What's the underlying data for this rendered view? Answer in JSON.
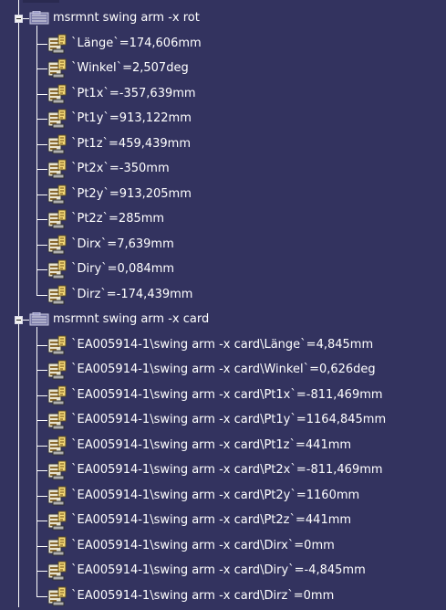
{
  "colors": {
    "background": "#33335f",
    "text": "#ffffff",
    "lines": "#ffffff"
  },
  "tree": [
    {
      "label": "msrmnt swing arm -x rot",
      "expanded": true,
      "icon": "parameter-set-icon",
      "children": [
        {
          "label": "`Länge`=174,606mm",
          "icon": "parameter-icon"
        },
        {
          "label": "`Winkel`=2,507deg",
          "icon": "parameter-icon"
        },
        {
          "label": "`Pt1x`=-357,639mm",
          "icon": "parameter-icon"
        },
        {
          "label": "`Pt1y`=913,122mm",
          "icon": "parameter-icon"
        },
        {
          "label": "`Pt1z`=459,439mm",
          "icon": "parameter-icon"
        },
        {
          "label": "`Pt2x`=-350mm",
          "icon": "parameter-icon"
        },
        {
          "label": "`Pt2y`=913,205mm",
          "icon": "parameter-icon"
        },
        {
          "label": "`Pt2z`=285mm",
          "icon": "parameter-icon"
        },
        {
          "label": "`Dirx`=7,639mm",
          "icon": "parameter-icon"
        },
        {
          "label": "`Diry`=0,084mm",
          "icon": "parameter-icon"
        },
        {
          "label": "`Dirz`=-174,439mm",
          "icon": "parameter-icon"
        }
      ]
    },
    {
      "label": "msrmnt swing arm -x card",
      "expanded": true,
      "icon": "parameter-set-icon",
      "children": [
        {
          "label": "`EA005914-1\\swing arm -x card\\Länge`=4,845mm",
          "icon": "parameter-icon"
        },
        {
          "label": "`EA005914-1\\swing arm -x card\\Winkel`=0,626deg",
          "icon": "parameter-icon"
        },
        {
          "label": "`EA005914-1\\swing arm -x card\\Pt1x`=-811,469mm",
          "icon": "parameter-icon"
        },
        {
          "label": "`EA005914-1\\swing arm -x card\\Pt1y`=1164,845mm",
          "icon": "parameter-icon"
        },
        {
          "label": "`EA005914-1\\swing arm -x card\\Pt1z`=441mm",
          "icon": "parameter-icon"
        },
        {
          "label": "`EA005914-1\\swing arm -x card\\Pt2x`=-811,469mm",
          "icon": "parameter-icon"
        },
        {
          "label": "`EA005914-1\\swing arm -x card\\Pt2y`=1160mm",
          "icon": "parameter-icon"
        },
        {
          "label": "`EA005914-1\\swing arm -x card\\Pt2z`=441mm",
          "icon": "parameter-icon"
        },
        {
          "label": "`EA005914-1\\swing arm -x card\\Dirx`=0mm",
          "icon": "parameter-icon"
        },
        {
          "label": "`EA005914-1\\swing arm -x card\\Diry`=-4,845mm",
          "icon": "parameter-icon"
        },
        {
          "label": "`EA005914-1\\swing arm -x card\\Dirz`=0mm",
          "icon": "parameter-icon"
        }
      ]
    }
  ]
}
